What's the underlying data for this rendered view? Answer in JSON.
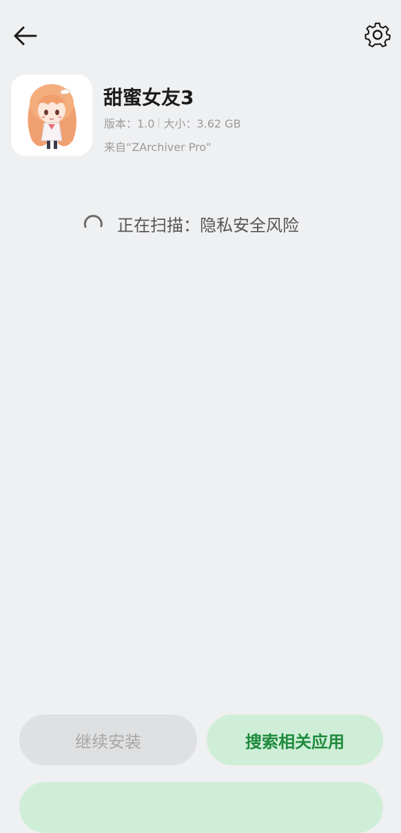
{
  "header": {
    "back_icon": "arrow-left-icon",
    "settings_icon": "gear-icon"
  },
  "app": {
    "name": "甜蜜女友3",
    "version_text": "版本：1.0",
    "size_text": "大小：3.62 GB",
    "source_text": "来自“ZArchiver Pro”",
    "icon": "app-character-icon"
  },
  "scan": {
    "status_text": "正在扫描：隐私安全风险",
    "icon": "loading-spinner-icon"
  },
  "actions": {
    "continue_label": "继续安装",
    "search_label": "搜索相关应用"
  },
  "colors": {
    "background": "#eff0f2",
    "accent_green": "#1e8a3c",
    "accent_green_bg": "#cfeed8",
    "disabled_bg": "#dfe0e2",
    "disabled_text": "#a7a7a7"
  }
}
